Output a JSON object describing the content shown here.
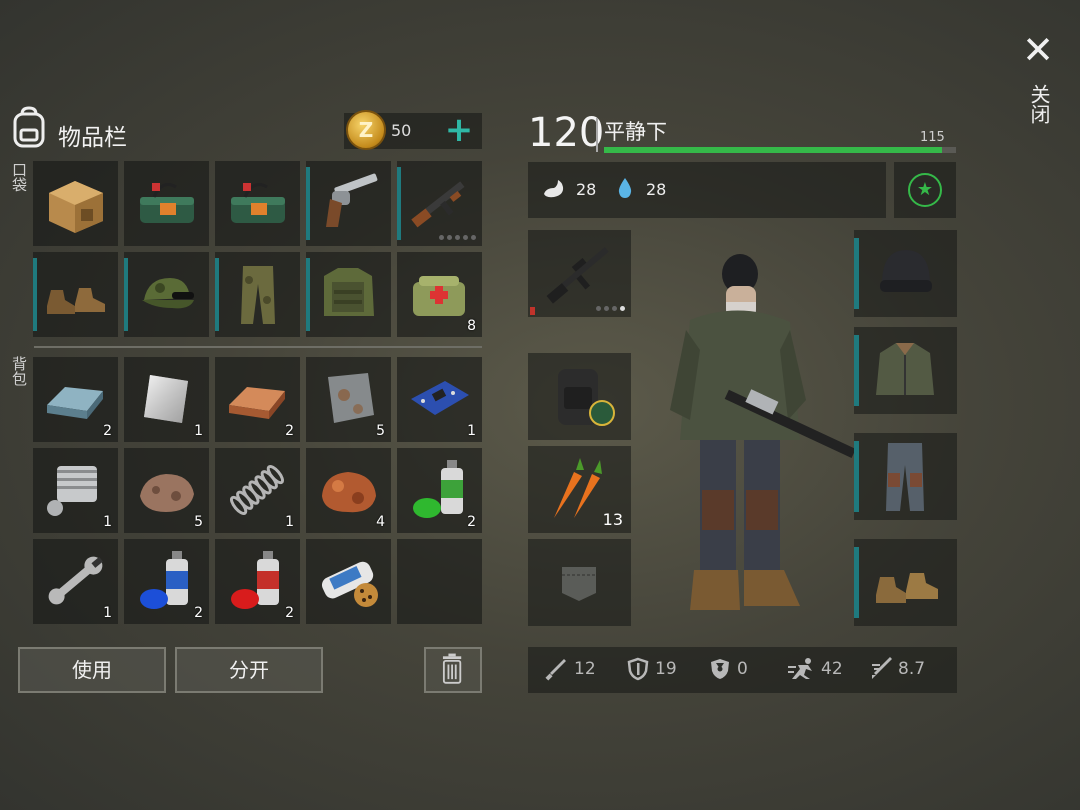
{
  "header": {
    "close_label": "关闭",
    "inventory_title": "物品栏",
    "coins": "50",
    "add_label": "+"
  },
  "sections": {
    "pockets": "口袋",
    "backpack": "背包"
  },
  "pocket_items": [
    {
      "icon": "cardboard-box-icon",
      "qty": ""
    },
    {
      "icon": "dynamite-bundle-icon",
      "qty": ""
    },
    {
      "icon": "dynamite-bundle-icon",
      "qty": ""
    },
    {
      "icon": "revolver-icon",
      "qty": ""
    },
    {
      "icon": "assault-rifle-icon",
      "qty": ""
    },
    {
      "icon": "boots-icon",
      "qty": ""
    },
    {
      "icon": "camo-cap-icon",
      "qty": ""
    },
    {
      "icon": "camo-pants-icon",
      "qty": ""
    },
    {
      "icon": "armored-vest-icon",
      "qty": ""
    },
    {
      "icon": "first-aid-bag-icon",
      "qty": "8"
    }
  ],
  "backpack_items": [
    {
      "icon": "steel-ingot-icon",
      "qty": "2"
    },
    {
      "icon": "aluminum-sheet-icon",
      "qty": "1"
    },
    {
      "icon": "copper-ingot-icon",
      "qty": "2"
    },
    {
      "icon": "iron-plate-icon",
      "qty": "5"
    },
    {
      "icon": "circuit-board-icon",
      "qty": "1"
    },
    {
      "icon": "engine-cylinder-icon",
      "qty": "1"
    },
    {
      "icon": "stone-ore-icon",
      "qty": "5"
    },
    {
      "icon": "spring-icon",
      "qty": "1"
    },
    {
      "icon": "copper-ore-icon",
      "qty": "4"
    },
    {
      "icon": "green-spray-paint-icon",
      "qty": "2"
    },
    {
      "icon": "wrench-icon",
      "qty": "1"
    },
    {
      "icon": "blue-spray-paint-icon",
      "qty": "2"
    },
    {
      "icon": "red-spray-paint-icon",
      "qty": "2"
    },
    {
      "icon": "leopard-paint-roll-icon",
      "qty": ""
    },
    {
      "icon": "",
      "qty": ""
    }
  ],
  "actions": {
    "use_label": "使用",
    "split_label": "分开"
  },
  "character": {
    "level": "120",
    "mood": "平静下",
    "hp": 115,
    "hp_max": 115,
    "hp_label": "115",
    "hunger": "28",
    "thirst": "28",
    "equipment_left": [
      {
        "icon": "m16-rifle-icon",
        "qty": ""
      },
      {
        "icon": "tactical-backpack-icon",
        "qty": ""
      },
      {
        "icon": "carrots-icon",
        "qty": "13"
      },
      {
        "icon": "pocket-slot-icon",
        "qty": ""
      }
    ],
    "equipment_right": [
      {
        "icon": "beanie-icon"
      },
      {
        "icon": "bomber-jacket-icon"
      },
      {
        "icon": "camo-pants-icon"
      },
      {
        "icon": "boots-icon"
      }
    ]
  },
  "bottom_stats": {
    "attack": "12",
    "defense": "19",
    "radiation": "0",
    "speed": "42",
    "stealth": "8.7"
  },
  "colors": {
    "accent_teal": "#1f7a7e",
    "health_green": "#35b949",
    "coin_gold": "#e0a83a"
  }
}
